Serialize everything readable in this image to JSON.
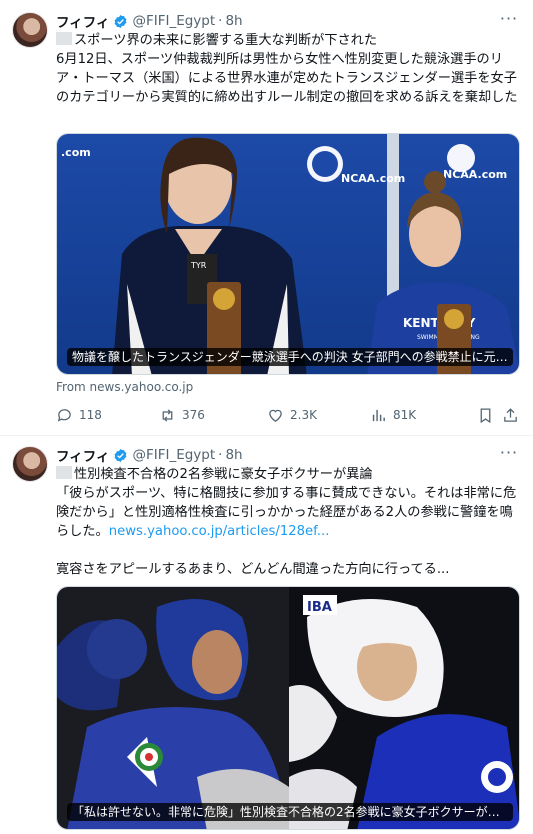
{
  "tweets": [
    {
      "name": "フィフィ",
      "handle": "@FIFI_Egypt",
      "dot": "·",
      "time": "8h",
      "more": "···",
      "text_line1": "スポーツ界の未来に影響する重大な判断が下された",
      "text_line2": "6月12日、スポーツ仲裁裁判所は男性から女性へ性別変更した競泳選手のリア・トーマス（米国）による世界水連が定めたトランスジェンダー選手を女子のカテゴリーから実質的に締め出すルール制定の撤回を求める訴えを棄却した",
      "media_caption": "物議を醸したトランスジェンダー競泳選手への判決 女子部門への参戦禁止に元金...",
      "media_texts": {
        "ncaa1": "NCAA.com",
        "ncaa2": "NCAA.com",
        "dotcom": ".com",
        "tyr": "TYR",
        "kentucky": "KENTUCKY",
        "swim": "SWIMMING & DIVING"
      },
      "from": "From news.yahoo.co.jp",
      "stats": {
        "replies": "118",
        "reposts": "376",
        "likes": "2.3K",
        "views": "81K"
      }
    },
    {
      "name": "フィフィ",
      "handle": "@FIFI_Egypt",
      "dot": "·",
      "time": "8h",
      "more": "···",
      "text_line1": "性別検査不合格の2名参戦に豪女子ボクサーが異論",
      "text_line2a": "「彼らがスポーツ、特に格闘技に参加する事に賛成できない。それは非常に危険だから」と性別適格性検査に引っかかった経歴がある2人の参戦に警鐘を鳴らした。",
      "text_link": "news.yahoo.co.jp/articles/128ef...",
      "text_line3": "寛容さをアピールするあまり、どんどん間違った方向に行ってる...",
      "media_caption": "「私は許せない。非常に危険」性別検査不合格の2名参戦に豪女子ボクサーが異...",
      "media_texts": {
        "iba": "IBA"
      }
    }
  ],
  "colors": {
    "verified": "#1d9bf0",
    "muted": "#536471",
    "link": "#1d9bf0"
  }
}
